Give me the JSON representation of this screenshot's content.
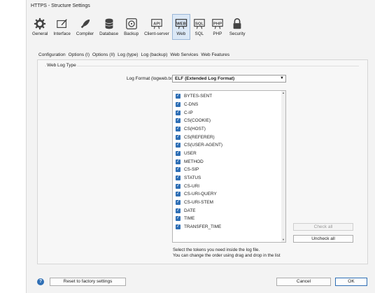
{
  "window": {
    "title": "HTTPS - Structure Settings"
  },
  "toolbar": [
    {
      "label": "General",
      "icon": "gear-icon"
    },
    {
      "label": "Interface",
      "icon": "interface-icon"
    },
    {
      "label": "Compiler",
      "icon": "rocket-icon"
    },
    {
      "label": "Database",
      "icon": "database-icon"
    },
    {
      "label": "Backup",
      "icon": "backup-icon"
    },
    {
      "label": "Client-server",
      "icon": "api-icon"
    },
    {
      "label": "Web",
      "icon": "web-icon"
    },
    {
      "label": "SQL",
      "icon": "sql-icon"
    },
    {
      "label": "PHP",
      "icon": "php-icon"
    },
    {
      "label": "Security",
      "icon": "padlock-icon"
    }
  ],
  "tabs": [
    "Configuration",
    "Options (I)",
    "Options (II)",
    "Log (type)",
    "Log (backup)",
    "Web Services",
    "Web Features"
  ],
  "panel": {
    "group_title": "Web Log Type",
    "format_label": "Log Format (logweb.txt):",
    "format_value": "ELF (Extended Log Format)",
    "tokens": [
      "BYTES-SENT",
      "C-DNS",
      "C-IP",
      "CS(COOKIE)",
      "CS(HOST)",
      "CS(REFERER)",
      "CS(USER-AGENT)",
      "USER",
      "METHOD",
      "CS-SIP",
      "STATUS",
      "CS-URI",
      "CS-URI-QUERY",
      "CS-URI-STEM",
      "DATE",
      "TIME",
      "TRANSFER_TIME"
    ],
    "check_all": "Check all",
    "uncheck_all": "Uncheck all",
    "hint_line1": "Select the tokens you need inside the log file.",
    "hint_line2": "You can change the order using drag and drop in the list"
  },
  "footer": {
    "help": "?",
    "reset": "Reset to factory settings",
    "cancel": "Cancel",
    "ok": "OK"
  },
  "colors": {
    "accent": "#2f6fb5",
    "active_tab_bg": "#dbe8f6"
  }
}
